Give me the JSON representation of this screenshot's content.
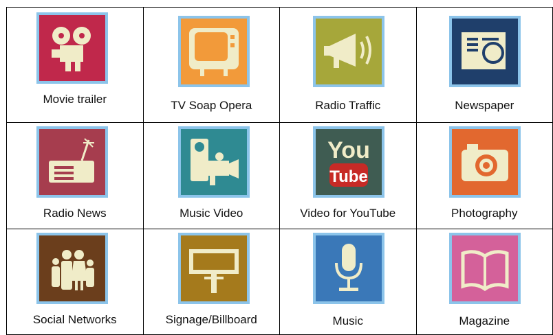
{
  "tiles": [
    {
      "label": "Movie trailer",
      "icon": "film-projector-icon",
      "color": "#c0284b"
    },
    {
      "label": "TV Soap Opera",
      "icon": "television-icon",
      "color": "#f29a3a"
    },
    {
      "label": "Radio Traffic",
      "icon": "megaphone-icon",
      "color": "#a6a73a"
    },
    {
      "label": "Newspaper",
      "icon": "newspaper-icon",
      "color": "#1f3f6b"
    },
    {
      "label": "Radio News",
      "icon": "radio-icon",
      "color": "#a63d4e"
    },
    {
      "label": "Music Video",
      "icon": "video-camera-icon",
      "color": "#2f8a92"
    },
    {
      "label": "Video for YouTube",
      "icon": "youtube-icon",
      "color": "#3f5c52"
    },
    {
      "label": "Photography",
      "icon": "camera-icon",
      "color": "#e2682f"
    },
    {
      "label": "Social Networks",
      "icon": "people-icon",
      "color": "#6b3e1c"
    },
    {
      "label": "Signage/Billboard",
      "icon": "billboard-icon",
      "color": "#a57a1c"
    },
    {
      "label": "Music",
      "icon": "microphone-icon",
      "color": "#3a78b8"
    },
    {
      "label": "Magazine",
      "icon": "magazine-icon",
      "color": "#d4619a"
    }
  ],
  "youtube": {
    "you": "You",
    "tube": "Tube"
  },
  "icon_fill": "#f0ecc8"
}
